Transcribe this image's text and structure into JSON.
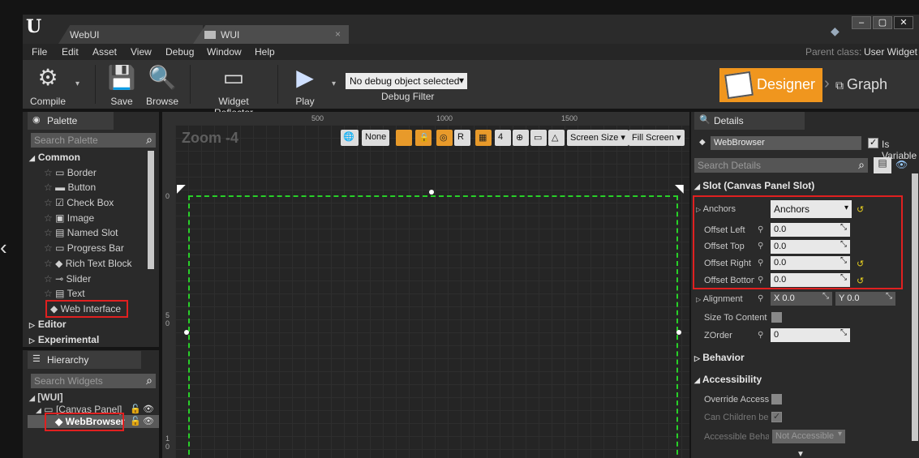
{
  "window": {
    "tabs": [
      {
        "label": "WebUI"
      },
      {
        "label": "WUI"
      }
    ],
    "controls": {
      "minimize": "–",
      "maximize": "▢",
      "close": "✕"
    },
    "parent_class_label": "Parent class:",
    "parent_class_value": "User Widget"
  },
  "menu": [
    "File",
    "Edit",
    "Asset",
    "View",
    "Debug",
    "Window",
    "Help"
  ],
  "toolbar": {
    "compile": "Compile",
    "save": "Save",
    "browse": "Browse",
    "widget_reflector": "Widget Reflector",
    "play": "Play",
    "debug_object": "No debug object selected",
    "debug_filter": "Debug Filter",
    "designer": "Designer",
    "graph": "Graph"
  },
  "palette": {
    "title": "Palette",
    "search_placeholder": "Search Palette",
    "common": "Common",
    "items": [
      "Border",
      "Button",
      "Check Box",
      "Image",
      "Named Slot",
      "Progress Bar",
      "Rich Text Block",
      "Slider",
      "Text",
      "Web Interface"
    ],
    "editor": "Editor",
    "experimental": "Experimental"
  },
  "hierarchy": {
    "title": "Hierarchy",
    "search_placeholder": "Search Widgets",
    "root": "[WUI]",
    "canvas": "[Canvas Panel]",
    "child": "WebBrowser"
  },
  "viewport": {
    "zoom": "Zoom -4",
    "ruler_top": [
      "500",
      "1000",
      "1500"
    ],
    "ruler_left": [
      "0",
      "5",
      "0",
      "1",
      "0"
    ],
    "none": "None",
    "r_label": "R",
    "screen_size": "Screen Size",
    "fill_screen": "Fill Screen"
  },
  "details": {
    "title": "Details",
    "name": "WebBrowser",
    "is_variable": "Is Variable",
    "search_placeholder": "Search Details",
    "slot_section": "Slot (Canvas Panel Slot)",
    "anchors_label": "Anchors",
    "anchors_value": "Anchors",
    "offset_left_label": "Offset Left",
    "offset_left": "0.0",
    "offset_top_label": "Offset Top",
    "offset_top": "0.0",
    "offset_right_label": "Offset Right",
    "offset_right": "0.0",
    "offset_bottom_label": "Offset Bottom",
    "offset_bottom": "0.0",
    "alignment_label": "Alignment",
    "alignment_x_label": "X",
    "alignment_x": "0.0",
    "alignment_y_label": "Y",
    "alignment_y": "0.0",
    "size_to_content": "Size To Content",
    "zorder_label": "ZOrder",
    "zorder": "0",
    "behavior": "Behavior",
    "accessibility": "Accessibility",
    "override_accessible": "Override Accessible",
    "can_children_be": "Can Children be Accessible",
    "accessible_behavior": "Accessible Behavior",
    "not_accessible": "Not Accessible"
  },
  "colors": {
    "accent_orange": "#f0961e",
    "highlight_red": "#e02020",
    "canvas_green": "#28d028"
  }
}
